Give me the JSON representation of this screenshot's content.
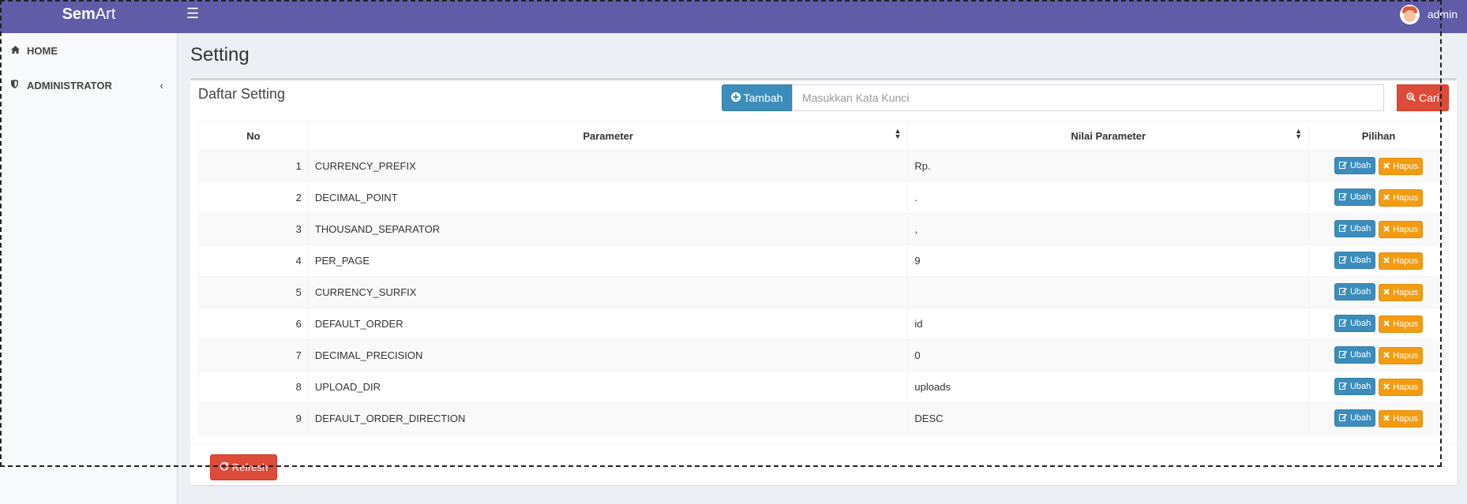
{
  "app": {
    "brand_bold": "Sem",
    "brand_light": "Art"
  },
  "header": {
    "menu_icon": "bars-icon",
    "username": "admin"
  },
  "sidebar": {
    "items": [
      {
        "label": "HOME",
        "icon": "home-icon"
      },
      {
        "label": "ADMINISTRATOR",
        "icon": "shield-icon"
      }
    ]
  },
  "page": {
    "title": "Setting"
  },
  "box": {
    "title": "Daftar Setting",
    "add_label": "Tambah",
    "search_placeholder": "Masukkan Kata Kunci",
    "search_value": "",
    "search_button_label": "Cari",
    "refresh_label": "Refresh"
  },
  "table": {
    "headers": [
      "No",
      "Parameter",
      "Nilai Parameter",
      "Pilihan"
    ],
    "edit_label": "Ubah",
    "delete_label": "Hapus",
    "rows": [
      {
        "no": "1",
        "parameter": "CURRENCY_PREFIX",
        "nilai": "Rp."
      },
      {
        "no": "2",
        "parameter": "DECIMAL_POINT",
        "nilai": "."
      },
      {
        "no": "3",
        "parameter": "THOUSAND_SEPARATOR",
        "nilai": ","
      },
      {
        "no": "4",
        "parameter": "PER_PAGE",
        "nilai": "9"
      },
      {
        "no": "5",
        "parameter": "CURRENCY_SURFIX",
        "nilai": ""
      },
      {
        "no": "6",
        "parameter": "DEFAULT_ORDER",
        "nilai": "id"
      },
      {
        "no": "7",
        "parameter": "DECIMAL_PRECISION",
        "nilai": "0"
      },
      {
        "no": "8",
        "parameter": "UPLOAD_DIR",
        "nilai": "uploads"
      },
      {
        "no": "9",
        "parameter": "DEFAULT_ORDER_DIRECTION",
        "nilai": "DESC"
      }
    ]
  },
  "colors": {
    "topbar": "#605ca8",
    "primary": "#3c8dbc",
    "danger": "#dd4b39",
    "warning": "#f39c12"
  }
}
